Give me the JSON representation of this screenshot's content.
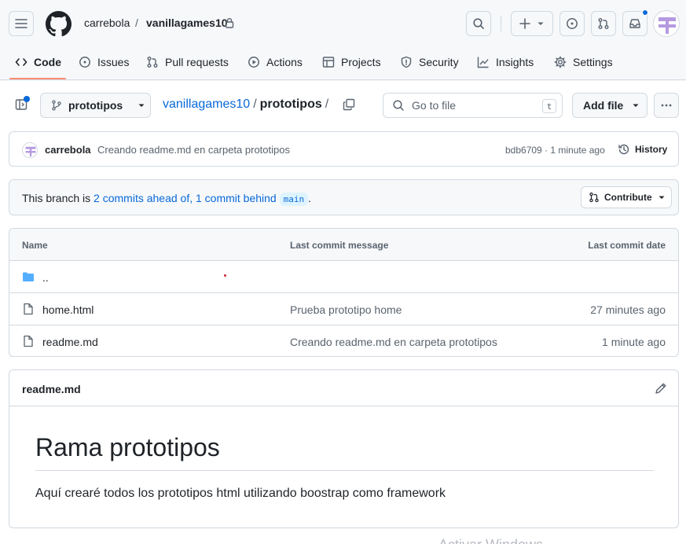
{
  "header": {
    "owner": "carrebola",
    "separator": "/",
    "repo": "vanillagames10"
  },
  "tabs": [
    {
      "label": "Code",
      "icon": "code-icon"
    },
    {
      "label": "Issues",
      "icon": "issue-icon"
    },
    {
      "label": "Pull requests",
      "icon": "pull-request-icon"
    },
    {
      "label": "Actions",
      "icon": "play-icon"
    },
    {
      "label": "Projects",
      "icon": "table-icon"
    },
    {
      "label": "Security",
      "icon": "shield-icon"
    },
    {
      "label": "Insights",
      "icon": "graph-icon"
    },
    {
      "label": "Settings",
      "icon": "gear-icon"
    }
  ],
  "toolbar": {
    "branch": "prototipos",
    "path_repo": "vanillagames10",
    "path_sep": "/",
    "path_current": "prototipos",
    "path_trailing": "/",
    "goto_placeholder": "Go to file",
    "goto_shortcut": "t",
    "add_file": "Add file"
  },
  "commit": {
    "author": "carrebola",
    "message": "Creando readme.md en carpeta prototipos",
    "meta": "bdb6709 · 1 minute ago",
    "history": "History"
  },
  "branch_status": {
    "prefix": "This branch is ",
    "ahead_behind": "2 commits ahead of, 1 commit behind",
    "base": "main",
    "suffix": ".",
    "contribute": "Contribute"
  },
  "files": {
    "headers": {
      "name": "Name",
      "message": "Last commit message",
      "date": "Last commit date"
    },
    "rows": [
      {
        "name": "..",
        "message": "",
        "date": "",
        "type": "folder"
      },
      {
        "name": "home.html",
        "message": "Prueba prototipo home",
        "date": "27 minutes ago",
        "type": "file"
      },
      {
        "name": "readme.md",
        "message": "Creando readme.md en carpeta prototipos",
        "date": "1 minute ago",
        "type": "file"
      }
    ]
  },
  "readme": {
    "filename": "readme.md",
    "heading": "Rama prototipos",
    "paragraph": "Aquí crearé todos los prototipos html utilizando boostrap como framework"
  },
  "watermark": "Activar Windows",
  "colors": {
    "accent": "#0969da",
    "tab_underline": "#fd8c73",
    "folder": "#54aeff"
  }
}
